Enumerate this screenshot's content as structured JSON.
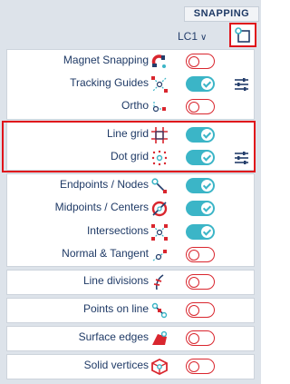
{
  "header": {
    "tab_label": "SNAPPING"
  },
  "load_case": {
    "value": "LC1"
  },
  "groups": [
    {
      "rows": [
        {
          "label": "Magnet Snapping",
          "icon": "magnet-icon",
          "state": "off",
          "has_settings": false
        },
        {
          "label": "Tracking Guides",
          "icon": "tracking-guides-icon",
          "state": "on",
          "has_settings": true
        },
        {
          "label": "Ortho",
          "icon": "ortho-icon",
          "state": "off",
          "has_settings": false
        }
      ]
    },
    {
      "rows": [
        {
          "label": "Line grid",
          "icon": "line-grid-icon",
          "state": "on",
          "has_settings": false
        },
        {
          "label": "Dot grid",
          "icon": "dot-grid-icon",
          "state": "on",
          "has_settings": true
        }
      ]
    },
    {
      "rows": [
        {
          "label": "Endpoints / Nodes",
          "icon": "endpoints-icon",
          "state": "on",
          "has_settings": false
        },
        {
          "label": "Midpoints / Centers",
          "icon": "midpoints-icon",
          "state": "on",
          "has_settings": false
        },
        {
          "label": "Intersections",
          "icon": "intersections-icon",
          "state": "on",
          "has_settings": false
        },
        {
          "label": "Normal & Tangent",
          "icon": "normal-tangent-icon",
          "state": "off",
          "has_settings": false
        }
      ]
    },
    {
      "rows": [
        {
          "label": "Line divisions",
          "icon": "line-divisions-icon",
          "state": "off",
          "has_settings": false
        }
      ]
    },
    {
      "rows": [
        {
          "label": "Points on line",
          "icon": "points-on-line-icon",
          "state": "off",
          "has_settings": false
        }
      ]
    },
    {
      "rows": [
        {
          "label": "Surface edges",
          "icon": "surface-edges-icon",
          "state": "off",
          "has_settings": false
        }
      ]
    },
    {
      "rows": [
        {
          "label": "Solid vertices",
          "icon": "solid-vertices-icon",
          "state": "off",
          "has_settings": false
        }
      ]
    }
  ],
  "colors": {
    "accent": "#3bb5c7",
    "off": "#d9262e",
    "highlight": "#e0141b",
    "text": "#1f3a66"
  }
}
